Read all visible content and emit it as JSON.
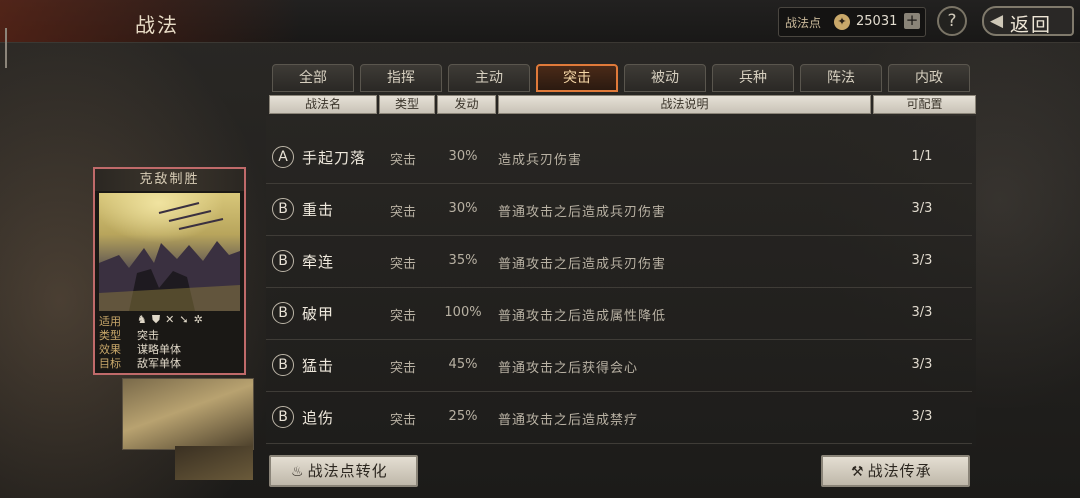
{
  "header": {
    "title": "战法",
    "points_label": "战法点",
    "points_value": "25031",
    "add_label": "+",
    "help_label": "?",
    "back_label": "返回"
  },
  "card": {
    "title": "克敌制胜",
    "stats": [
      {
        "key": "适用",
        "value": ""
      },
      {
        "key": "类型",
        "value": "突击"
      },
      {
        "key": "效果",
        "value": "谋略单体"
      },
      {
        "key": "目标",
        "value": "敌军单体"
      }
    ],
    "troop_icons": [
      "cavalry-icon",
      "shield-icon",
      "bow-icon",
      "spear-icon",
      "siege-icon"
    ]
  },
  "tabs": [
    {
      "label": "全部",
      "active": false
    },
    {
      "label": "指挥",
      "active": false
    },
    {
      "label": "主动",
      "active": false
    },
    {
      "label": "突击",
      "active": true
    },
    {
      "label": "被动",
      "active": false
    },
    {
      "label": "兵种",
      "active": false
    },
    {
      "label": "阵法",
      "active": false
    },
    {
      "label": "内政",
      "active": false
    }
  ],
  "columns": [
    "战法名",
    "类型",
    "发动",
    "战法说明",
    "可配置"
  ],
  "rows": [
    {
      "grade": "A",
      "name": "手起刀落",
      "type": "突击",
      "rate": "30%",
      "desc": "造成兵刃伤害",
      "config": "1/1"
    },
    {
      "grade": "B",
      "name": "重击",
      "type": "突击",
      "rate": "30%",
      "desc": "普通攻击之后造成兵刃伤害",
      "config": "3/3"
    },
    {
      "grade": "B",
      "name": "牵连",
      "type": "突击",
      "rate": "35%",
      "desc": "普通攻击之后造成兵刃伤害",
      "config": "3/3"
    },
    {
      "grade": "B",
      "name": "破甲",
      "type": "突击",
      "rate": "100%",
      "desc": "普通攻击之后造成属性降低",
      "config": "3/3"
    },
    {
      "grade": "B",
      "name": "猛击",
      "type": "突击",
      "rate": "45%",
      "desc": "普通攻击之后获得会心",
      "config": "3/3"
    },
    {
      "grade": "B",
      "name": "追伤",
      "type": "突击",
      "rate": "25%",
      "desc": "普通攻击之后造成禁疗",
      "config": "3/3"
    }
  ],
  "buttons": {
    "convert": "战法点转化",
    "inherit": "战法传承"
  },
  "colors": {
    "active_tab_border": "#e07a3a",
    "card_border": "#c06a6a"
  }
}
